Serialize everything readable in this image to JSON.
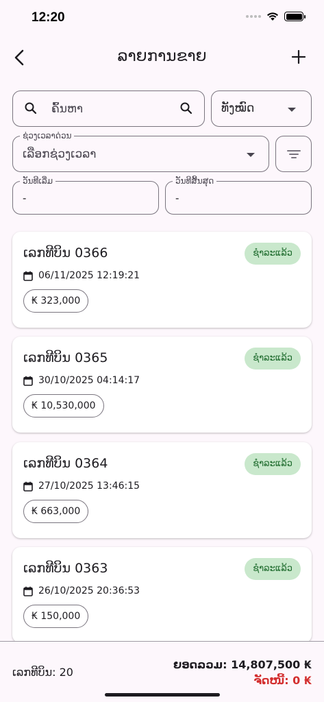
{
  "status_bar": {
    "time": "12:20"
  },
  "header": {
    "title": "ລາຍການຂາຍ"
  },
  "search": {
    "placeholder": "ຄົ້ນຫາ"
  },
  "type_filter": {
    "selected": "ທັງໝົດ"
  },
  "period_filter": {
    "label": "ຊ່ວງເວລາດ່ວນ",
    "placeholder": "ເລືອກຊ່ວງເວລາ"
  },
  "start_date": {
    "label": "ວັນທີເລີ່ມ",
    "value": "-"
  },
  "end_date": {
    "label": "ວັນທີສິ້ນສຸດ",
    "value": "-"
  },
  "bills": [
    {
      "title": "ເລກທີບິນ 0366",
      "status": "ຊໍາລະແລ້ວ",
      "datetime": "06/11/2025 12:19:21",
      "amount": "₭ 323,000"
    },
    {
      "title": "ເລກທີບິນ 0365",
      "status": "ຊໍາລະແລ້ວ",
      "datetime": "30/10/2025 04:14:17",
      "amount": "₭ 10,530,000"
    },
    {
      "title": "ເລກທີບິນ 0364",
      "status": "ຊໍາລະແລ້ວ",
      "datetime": "27/10/2025 13:46:15",
      "amount": "₭ 663,000"
    },
    {
      "title": "ເລກທີບິນ 0363",
      "status": "ຊໍາລະແລ້ວ",
      "datetime": "26/10/2025 20:36:53",
      "amount": "₭ 150,000"
    }
  ],
  "summary": {
    "bill_count": "ເລກທີບິນ: 20",
    "total": "ຍອດລວມ: 14,807,500 ₭",
    "debt": "ຈັດໜີ້: 0 ₭"
  },
  "colors": {
    "paid_badge_bg": "#c9e8cc",
    "paid_badge_text": "#1e6b2d",
    "debt_text": "#d32f2f"
  }
}
